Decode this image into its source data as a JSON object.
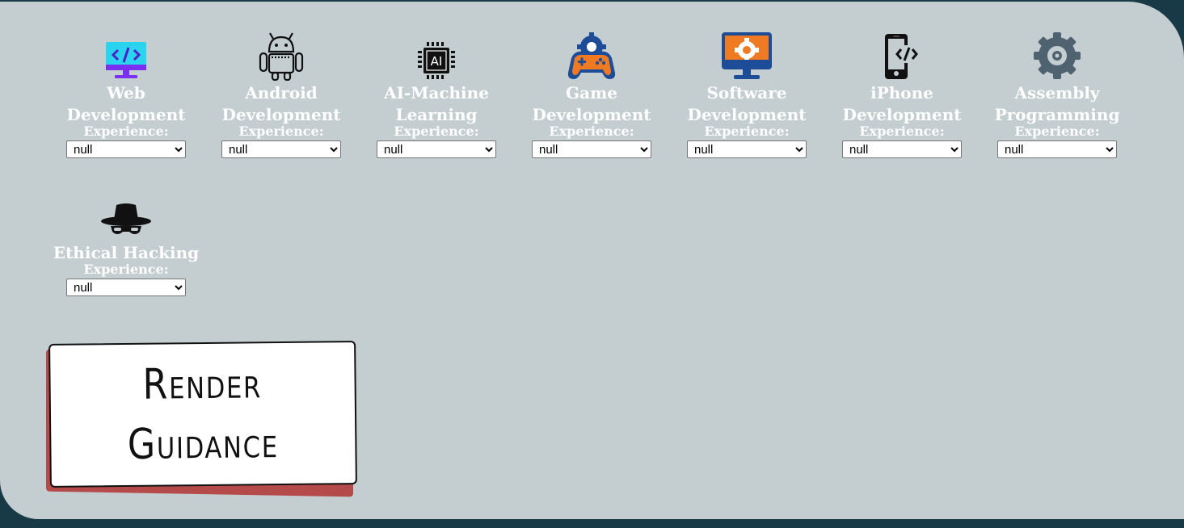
{
  "experience_label": "Experience:",
  "skills": [
    {
      "title": "Web Development",
      "icon": "monitor-code-icon",
      "value": "null"
    },
    {
      "title": "Android Development",
      "icon": "android-robot-icon",
      "value": "null"
    },
    {
      "title": "AI-Machine Learning",
      "icon": "ai-chip-icon",
      "value": "null"
    },
    {
      "title": "Game Development",
      "icon": "gamepad-gear-icon",
      "value": "null"
    },
    {
      "title": "Software Development",
      "icon": "monitor-gear-icon",
      "value": "null"
    },
    {
      "title": "iPhone Development",
      "icon": "phone-code-icon",
      "value": "null"
    },
    {
      "title": "Assembly Programming",
      "icon": "gear-icon",
      "value": "null"
    },
    {
      "title": "Ethical Hacking",
      "icon": "hacker-hat-icon",
      "value": "null"
    }
  ],
  "render_button": {
    "line1": "Render",
    "line2": "Guidance"
  },
  "colors": {
    "background": "#173a46",
    "panel": "#c4cdd0",
    "button_shadow": "#b44a4a"
  }
}
